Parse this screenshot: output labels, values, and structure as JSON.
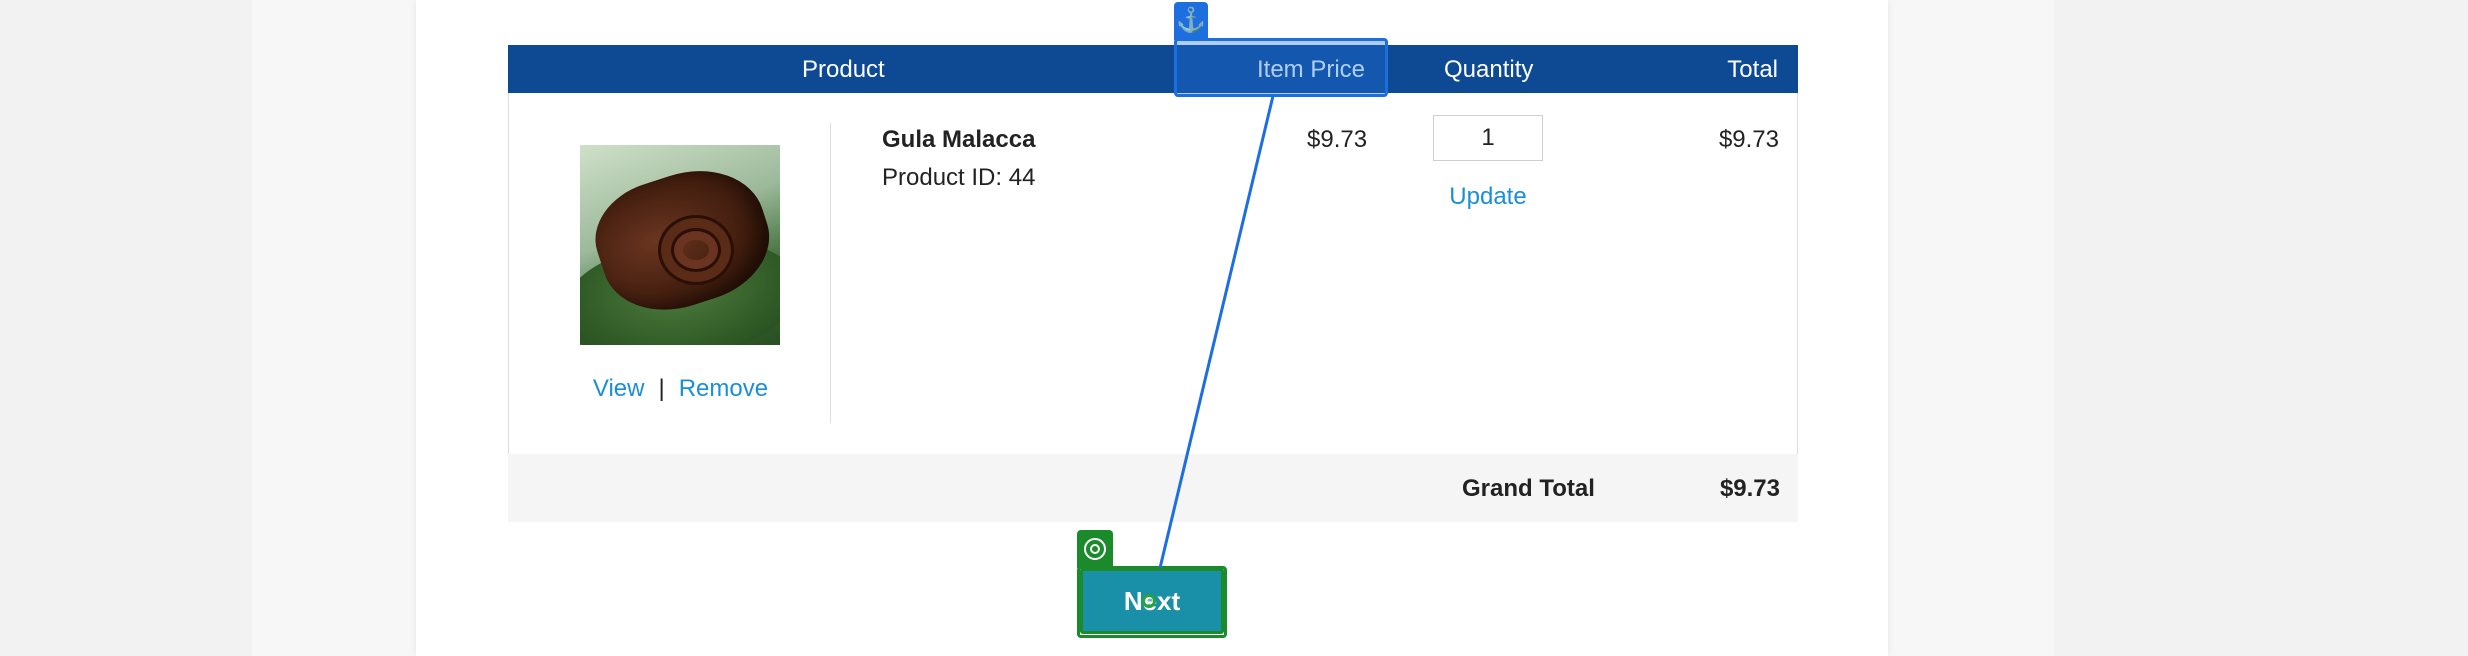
{
  "cart": {
    "columns": {
      "product": "Product",
      "item_price": "Item Price",
      "quantity": "Quantity",
      "total": "Total"
    },
    "item": {
      "name": "Gula Malacca",
      "product_id": "Product ID: 44",
      "price": "$9.73",
      "quantity": "1",
      "line_total": "$9.73",
      "image_icon": "product-photo",
      "view_link": "View",
      "link_separator": "|",
      "remove_link": "Remove",
      "update_link": "Update"
    },
    "grand_total_label": "Grand Total",
    "grand_total_value": "$9.73"
  },
  "actions": {
    "next_label": "Next"
  },
  "overlay": {
    "anchor_icon": "anchor-icon",
    "target_icon": "target-icon",
    "anchor_glyph": "⚓",
    "anchor_color": "#1d6fe0",
    "target_color": "#1b8a2a"
  },
  "colors": {
    "header_bg": "#0e4a94",
    "link": "#1a8fd8",
    "button_bg": "#1a8fa8"
  }
}
